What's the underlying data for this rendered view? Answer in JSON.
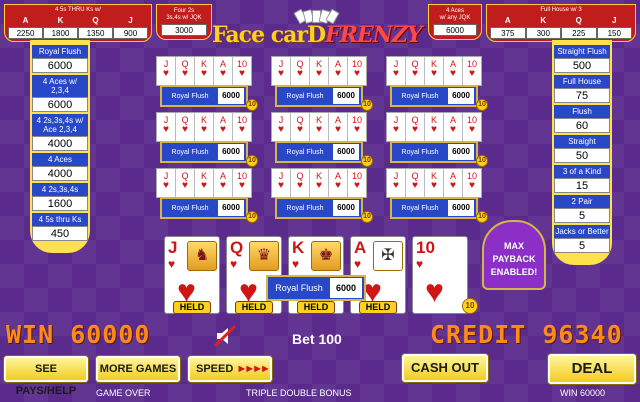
{
  "top_left_bonus": {
    "title": "4 5s THRU Ks w/",
    "headers": [
      "A",
      "K",
      "Q",
      "J"
    ],
    "values": [
      "2250",
      "1800",
      "1350",
      "900"
    ]
  },
  "top_left_small": {
    "title_line1": "Four 2s",
    "title_line2": "3s,4s w/ JQK",
    "value": "3000"
  },
  "top_right_small": {
    "title_line1": "4 Aces",
    "title_line2": "w/ any JQK",
    "value": "6000"
  },
  "top_right_bonus": {
    "title": "Full House w/ 3",
    "headers": [
      "A",
      "K",
      "Q",
      "J"
    ],
    "values": [
      "375",
      "300",
      "225",
      "150"
    ]
  },
  "logo": {
    "word1": "Face carD",
    "word2": "FRENZY"
  },
  "left_paytable": [
    {
      "label": "Royal Flush",
      "value": "6000"
    },
    {
      "label": "4 Aces w/ 2,3,4",
      "value": "6000"
    },
    {
      "label": "4 2s,3s,4s w/ Ace 2,3,4",
      "value": "4000"
    },
    {
      "label": "4 Aces",
      "value": "4000"
    },
    {
      "label": "4 2s,3s,4s",
      "value": "1600"
    },
    {
      "label": "4 5s thru Ks",
      "value": "450"
    }
  ],
  "right_paytable": [
    {
      "label": "Straight Flush",
      "value": "500"
    },
    {
      "label": "Full House",
      "value": "75"
    },
    {
      "label": "Flush",
      "value": "60"
    },
    {
      "label": "Straight",
      "value": "50"
    },
    {
      "label": "3 of a Kind",
      "value": "15"
    },
    {
      "label": "2 Pair",
      "value": "5"
    },
    {
      "label": "Jacks or Better",
      "value": "5"
    }
  ],
  "mini_hands": {
    "cards": [
      "J",
      "Q",
      "K",
      "A",
      "10"
    ],
    "result_label": "Royal Flush",
    "result_value": "6000",
    "coin": "10"
  },
  "main_hand": {
    "cards": [
      {
        "rank": "J",
        "held": "HELD"
      },
      {
        "rank": "Q",
        "held": "HELD"
      },
      {
        "rank": "K",
        "held": "HELD"
      },
      {
        "rank": "A",
        "held": "HELD"
      },
      {
        "rank": "10",
        "held": "HELD"
      }
    ],
    "result_label": "Royal Flush",
    "result_value": "6000",
    "coin": "10"
  },
  "max_payback": {
    "line1": "MAX",
    "line2": "PAYBACK",
    "line3": "ENABLED!"
  },
  "win_text": "WIN 60000",
  "bet_text": "Bet 100",
  "credit_text": "CREDIT 96340",
  "buttons": {
    "pays": "SEE PAYS/HELP",
    "more_games": "MORE GAMES",
    "speed": "SPEED",
    "cash_out": "CASH OUT",
    "deal": "DEAL"
  },
  "footer": {
    "left": "GAME OVER",
    "center": "TRIPLE DOUBLE BONUS",
    "right": "WIN 60000"
  },
  "colors": {
    "background": "#5a2a8c",
    "accent_red": "#c21d1d",
    "paytable_blue": "#2848c8",
    "gold": "#ffd020"
  }
}
